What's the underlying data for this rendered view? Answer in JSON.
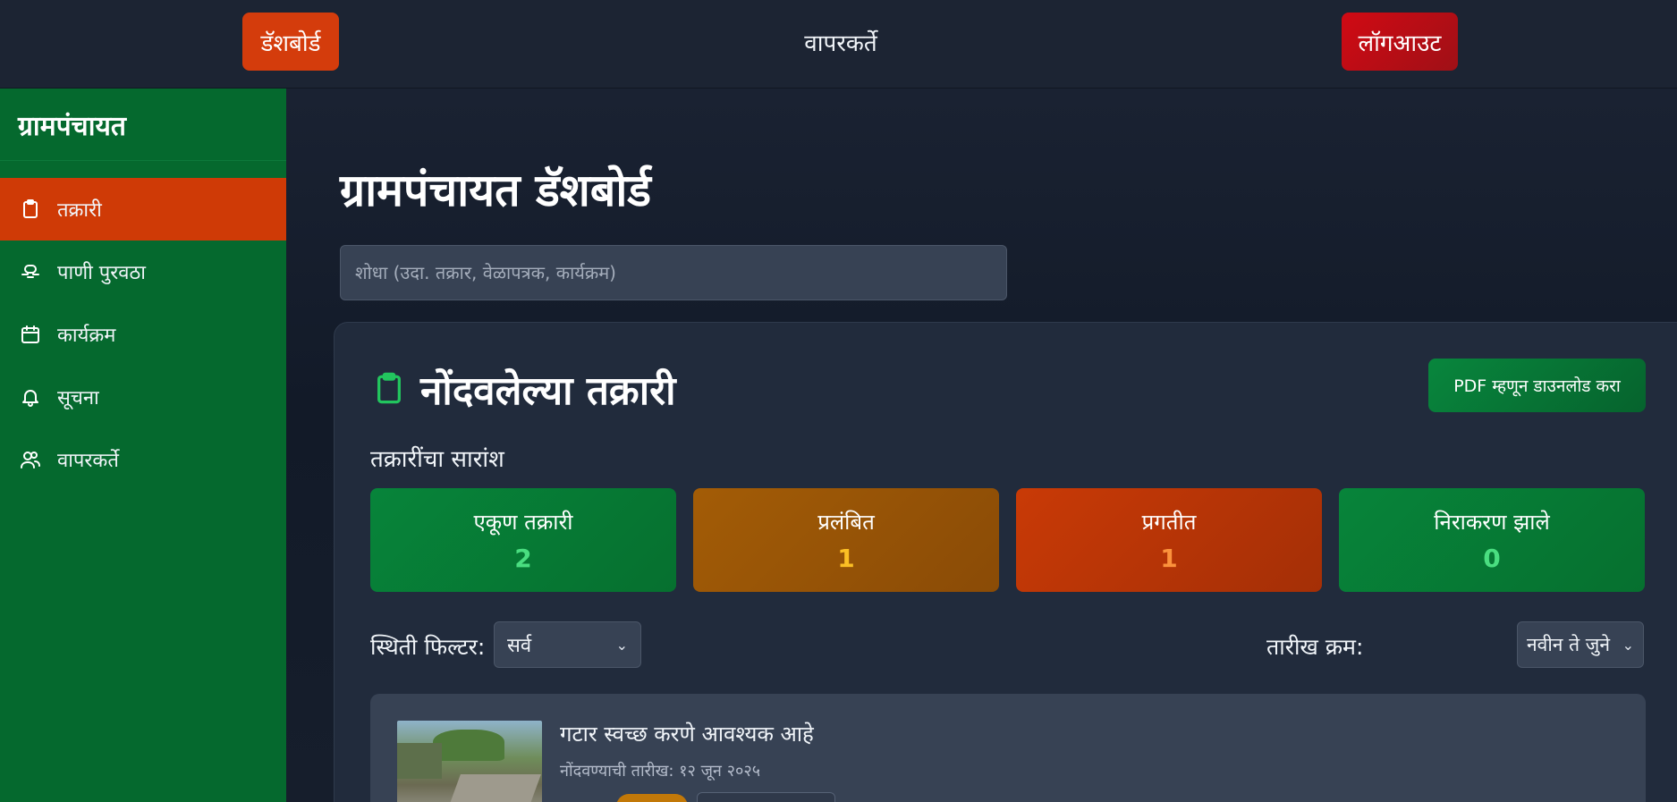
{
  "topbar": {
    "dashboard_label": "डॅशबोर्ड",
    "users_label": "वापरकर्ते",
    "logout_label": "लॉगआउट"
  },
  "sidebar": {
    "brand": "ग्रामपंचायत",
    "items": [
      {
        "label": "तक्रारी",
        "icon": "clipboard-icon",
        "active": true
      },
      {
        "label": "पाणी पुरवठा",
        "icon": "water-tap-icon",
        "active": false
      },
      {
        "label": "कार्यक्रम",
        "icon": "calendar-icon",
        "active": false
      },
      {
        "label": "सूचना",
        "icon": "bell-icon",
        "active": false
      },
      {
        "label": "वापरकर्ते",
        "icon": "users-icon",
        "active": false
      }
    ]
  },
  "main": {
    "title": "ग्रामपंचायत डॅशबोर्ड",
    "search_placeholder": "शोधा (उदा. तक्रार, वेळापत्रक, कार्यक्रम)"
  },
  "complaints": {
    "header_icon": "clipboard-icon",
    "title": "नोंदवलेल्या तक्रारी",
    "pdf_button": "PDF म्हणून डाउनलोड करा",
    "summary_label": "तक्रारींचा सारांश",
    "stats": {
      "total": {
        "label": "एकूण तक्रारी",
        "value": "2"
      },
      "pending": {
        "label": "प्रलंबित",
        "value": "1"
      },
      "in_progress": {
        "label": "प्रगतीत",
        "value": "1"
      },
      "resolved": {
        "label": "निराकरण झाले",
        "value": "0"
      }
    },
    "status_filter_label": "स्थिती फिल्टर:",
    "status_filter_value": "सर्व",
    "date_sort_label": "तारीख क्रम:",
    "date_sort_value": "नवीन ते जुने",
    "items": [
      {
        "title": "गटार स्वच्छ करणे आवश्यक आहे",
        "date": "नोंदवण्याची तारीख: १२ जून २०२५"
      }
    ]
  },
  "colors": {
    "sidebar": "#05692e",
    "active_nav": "#cf3a06",
    "dashboard_button": "#d43c0c",
    "logout_button": "#d10a14",
    "accent_green": "#22c55e"
  }
}
